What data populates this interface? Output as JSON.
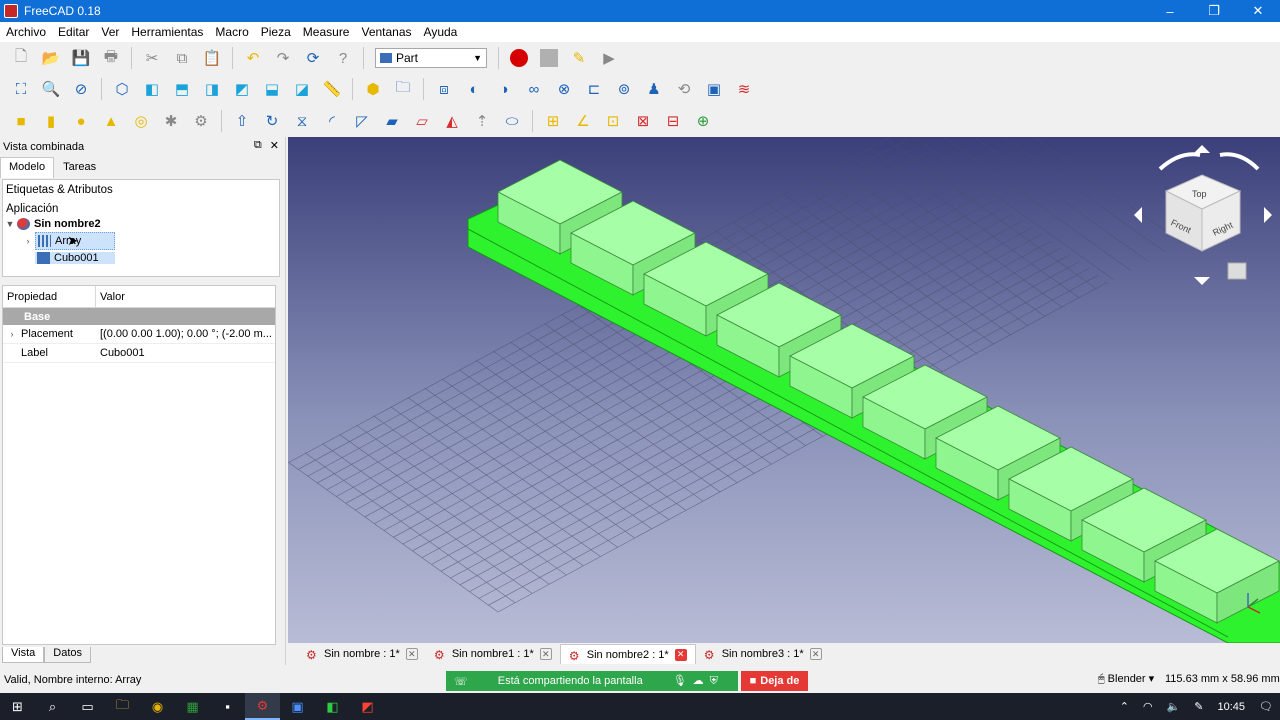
{
  "window": {
    "title": "FreeCAD 0.18",
    "controls": [
      "–",
      "❐",
      "✕"
    ]
  },
  "menu": [
    "Archivo",
    "Editar",
    "Ver",
    "Herramientas",
    "Macro",
    "Pieza",
    "Measure",
    "Ventanas",
    "Ayuda"
  ],
  "toolbar": {
    "workbench": "Part"
  },
  "panel": {
    "title": "Vista combinada",
    "tabs": [
      "Modelo",
      "Tareas"
    ],
    "tree_header": "Etiquetas & Atributos",
    "section": "Aplicación",
    "document": "Sin nombre2",
    "items": [
      {
        "label": "Array"
      },
      {
        "label": "Cubo001"
      }
    ],
    "property_columns": [
      "Propiedad",
      "Valor"
    ],
    "group": "Base",
    "properties": [
      {
        "key": "Placement",
        "value": "[(0.00 0.00 1.00); 0.00 °; (-2.00 m..."
      },
      {
        "key": "Label",
        "value": "Cubo001"
      }
    ],
    "bottom_tabs": [
      "Vista",
      "Datos"
    ]
  },
  "navcube": {
    "faces": [
      "Top",
      "Front",
      "Right"
    ]
  },
  "document_tabs": [
    {
      "label": "Sin nombre : 1*",
      "active": false
    },
    {
      "label": "Sin nombre1 : 1*",
      "active": false
    },
    {
      "label": "Sin nombre2 : 1*",
      "active": true
    },
    {
      "label": "Sin nombre3 : 1*",
      "active": false
    }
  ],
  "status": {
    "text": "Valid, Nombre interno: Array",
    "sharing": "Está compartiendo la pantalla",
    "stop_sharing": "Deja de",
    "navigation": "Blender",
    "dimensions": "115.63 mm x 58.96 mm"
  },
  "taskbar": {
    "time": "10:45"
  },
  "colors": {
    "accent": "#0f6fd6",
    "solid_green": "#33ff33",
    "box_green": "#99ff99"
  }
}
